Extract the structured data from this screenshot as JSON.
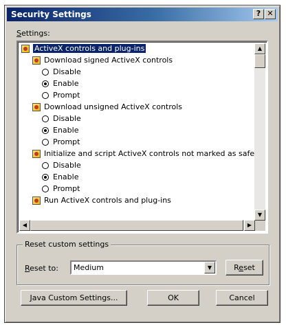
{
  "window": {
    "title": "Security Settings",
    "help_label": "?",
    "close_label": "✕"
  },
  "settings_label": {
    "accel": "S",
    "rest": "ettings:"
  },
  "list": {
    "items": [
      {
        "kind": "category",
        "label": "ActiveX controls and plug-ins",
        "selected": true
      },
      {
        "kind": "category",
        "label": "Download signed ActiveX controls"
      },
      {
        "kind": "option",
        "label": "Disable",
        "checked": false
      },
      {
        "kind": "option",
        "label": "Enable",
        "checked": true
      },
      {
        "kind": "option",
        "label": "Prompt",
        "checked": false
      },
      {
        "kind": "category",
        "label": "Download unsigned ActiveX controls"
      },
      {
        "kind": "option",
        "label": "Disable",
        "checked": false
      },
      {
        "kind": "option",
        "label": "Enable",
        "checked": true
      },
      {
        "kind": "option",
        "label": "Prompt",
        "checked": false
      },
      {
        "kind": "category",
        "label": "Initialize and script ActiveX controls not marked as safe"
      },
      {
        "kind": "option",
        "label": "Disable",
        "checked": false
      },
      {
        "kind": "option",
        "label": "Enable",
        "checked": true
      },
      {
        "kind": "option",
        "label": "Prompt",
        "checked": false
      },
      {
        "kind": "category",
        "label": "Run ActiveX controls and plug-ins"
      }
    ]
  },
  "reset_group": {
    "title": "Reset custom settings",
    "reset_to_accel": "R",
    "reset_to_rest": "eset to:",
    "selected_level": "Medium",
    "reset_button_pre": "R",
    "reset_button_accel": "e",
    "reset_button_post": "set"
  },
  "buttons": {
    "java_accel": "J",
    "java_rest": "ava Custom Settings...",
    "ok": "OK",
    "cancel": "Cancel"
  }
}
